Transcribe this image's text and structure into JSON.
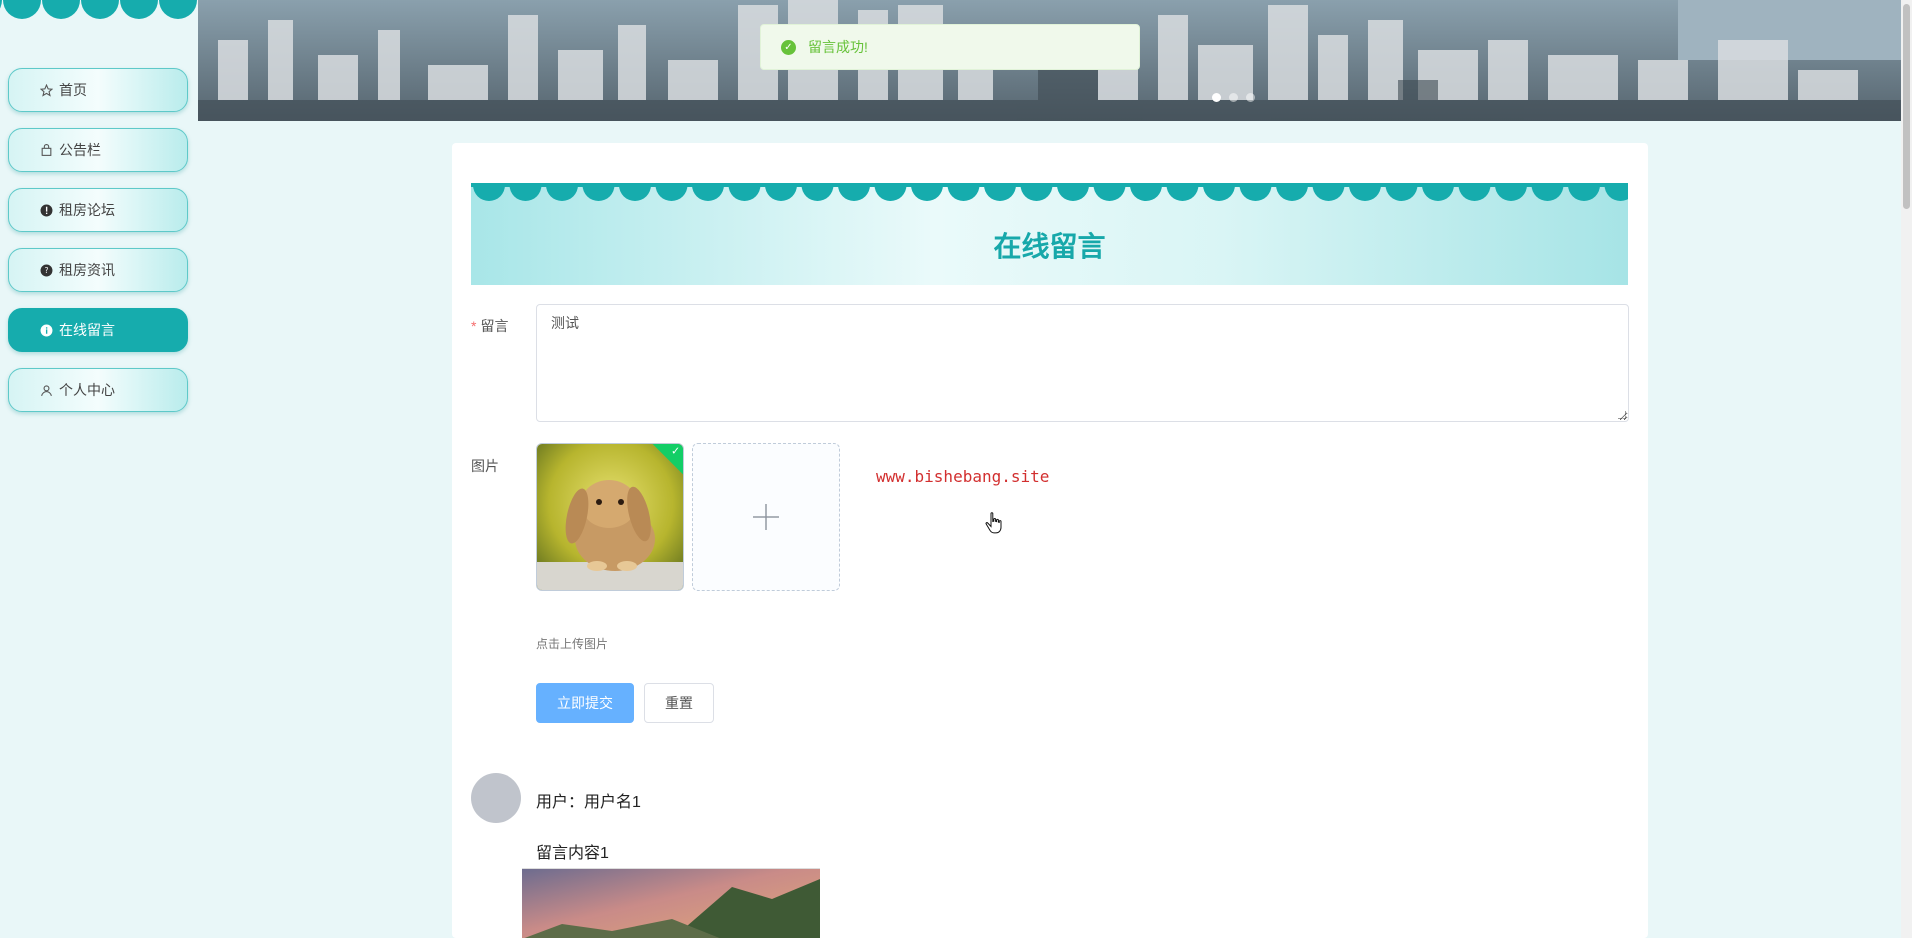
{
  "sidebar": {
    "items": [
      {
        "label": "首页",
        "icon": "star-icon",
        "active": false
      },
      {
        "label": "公告栏",
        "icon": "bag-icon",
        "active": false
      },
      {
        "label": "租房论坛",
        "icon": "exclamation-icon",
        "active": false
      },
      {
        "label": "租房资讯",
        "icon": "question-icon",
        "active": false
      },
      {
        "label": "在线留言",
        "icon": "info-icon",
        "active": true
      },
      {
        "label": "个人中心",
        "icon": "user-icon",
        "active": false
      }
    ]
  },
  "toast": {
    "message": "留言成功!",
    "icon": "success-check-icon",
    "color": "#67c23a"
  },
  "form": {
    "title": "在线留言",
    "message_label": "留言",
    "message_value": "测试",
    "image_label": "图片",
    "upload_hint": "点击上传图片",
    "submit_label": "立即提交",
    "reset_label": "重置"
  },
  "watermark": "www.bishebang.site",
  "messages": [
    {
      "user": "用户：用户名1",
      "content": "留言内容1"
    }
  ],
  "colors": {
    "accent": "#16acad",
    "primary_button": "#66b1ff",
    "title": "#17a8aa"
  }
}
